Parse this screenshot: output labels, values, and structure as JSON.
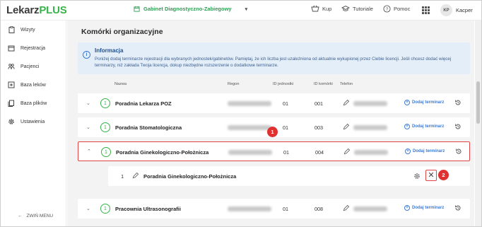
{
  "app": {
    "logo_part1": "Lekarz",
    "logo_part2": "PLUS",
    "clinic_name": "Gabinet Diagnostyczno-Zabiegowy"
  },
  "topnav": {
    "shop": "Kup",
    "tutorials": "Tutoriale",
    "help": "Pomoc",
    "avatar_initials": "KP",
    "user_name": "Kacper"
  },
  "sidebar": {
    "items": [
      {
        "label": "Wizyty",
        "icon": "clipboard-icon"
      },
      {
        "label": "Rejestracja",
        "icon": "calendar-icon"
      },
      {
        "label": "Pacjenci",
        "icon": "people-icon"
      },
      {
        "label": "Baza leków",
        "icon": "medicine-icon"
      },
      {
        "label": "Baza plików",
        "icon": "files-icon"
      },
      {
        "label": "Ustawienia",
        "icon": "gear-icon"
      }
    ],
    "collapse_label": "ZWIŃ MENU"
  },
  "main": {
    "title": "Komórki organizacyjne",
    "info": {
      "title": "Informacja",
      "text": "Poniżej dodaj terminarze rejestracji dla wybranych jednostek/gabinetów. Pamiętaj, że ich liczba jest uzależniona od aktualnie wykupionej przez Ciebie licencji. Jeśli chcesz dodać więcej terminarzy, niż zakłada Twoja licencja, dokup niezbędne rozszerzenie o dodatkowe terminarze."
    },
    "columns": {
      "name": "Nazwa",
      "region": "Regon",
      "id_unit": "ID jednostki",
      "id_cell": "ID komórki",
      "phone": "Telefon"
    },
    "rows": [
      {
        "count": "1",
        "name": "Poradnia Lekarza POZ",
        "id_unit": "01",
        "id_cell": "001",
        "add_label": "Dodaj terminarz"
      },
      {
        "count": "1",
        "name": "Poradnia Stomatologiczna",
        "id_unit": "01",
        "id_cell": "003",
        "add_label": "Dodaj terminarz"
      },
      {
        "count": "1",
        "name": "Poradnia Ginekologiczno-Położnicza",
        "id_unit": "01",
        "id_cell": "004",
        "add_label": "Dodaj terminarz"
      },
      {
        "count": "1",
        "name": "Pracownia Ultrasonografii",
        "id_unit": "01",
        "id_cell": "008",
        "add_label": "Dodaj terminarz"
      }
    ],
    "subrow": {
      "number": "1",
      "name": "Poradnia Ginekologiczno-Położnicza"
    },
    "callouts": [
      "1",
      "2"
    ]
  }
}
